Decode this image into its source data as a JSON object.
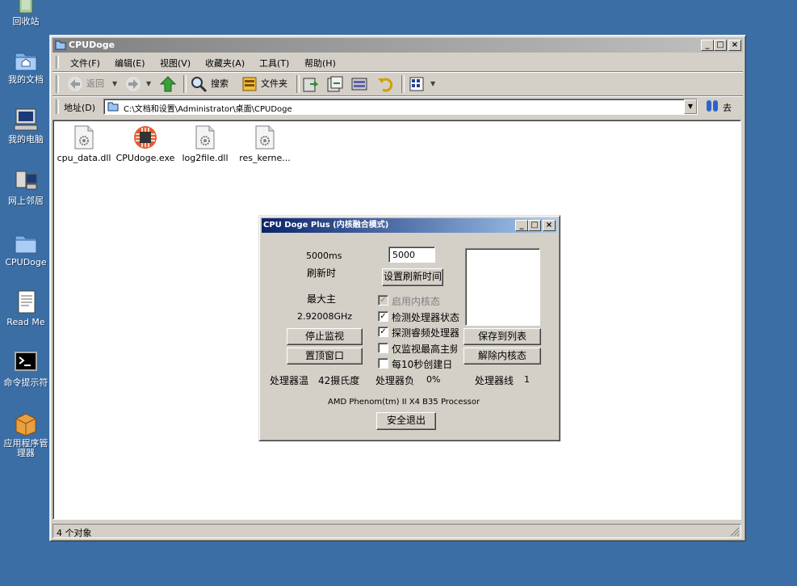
{
  "desktop": {
    "icons": [
      {
        "label": "回收站"
      },
      {
        "label": "我的文档"
      },
      {
        "label": "我的电脑"
      },
      {
        "label": "网上邻居"
      },
      {
        "label": "CPUDoge"
      },
      {
        "label": "Read Me"
      },
      {
        "label": "命令提示符"
      },
      {
        "label": "应用程序管理器"
      }
    ]
  },
  "explorer": {
    "title": "CPUDoge",
    "menu": [
      "文件(F)",
      "编辑(E)",
      "视图(V)",
      "收藏夹(A)",
      "工具(T)",
      "帮助(H)"
    ],
    "toolbar": {
      "back": "返回",
      "search": "搜索",
      "folders": "文件夹"
    },
    "address": {
      "label": "地址(D)",
      "value": "C:\\文档和设置\\Administrator\\桌面\\CPUDoge",
      "go": "去"
    },
    "files": [
      {
        "name": "cpu_data.dll"
      },
      {
        "name": "CPUdoge.exe"
      },
      {
        "name": "log2file.dll"
      },
      {
        "name": "res_kerne..."
      }
    ],
    "status": "4 个对象"
  },
  "dialog": {
    "title": "CPU Doge Plus (内核融合模式)",
    "refresh_ms": "5000ms",
    "refresh_label": "刷新时",
    "interval_input": "5000",
    "set_interval_button": "设置刷新时间",
    "max_label": "最大主",
    "max_freq": "2.92008GHz",
    "stop_button": "停止监视",
    "top_button": "置顶窗口",
    "checks": [
      {
        "label": "启用内核态",
        "checked": true,
        "disabled": true
      },
      {
        "label": "检测处理器状态",
        "checked": true,
        "disabled": false
      },
      {
        "label": "探测睿频处理器",
        "checked": true,
        "disabled": false
      },
      {
        "label": "仅监视最高主频",
        "checked": false,
        "disabled": false
      },
      {
        "label": "每10秒创建日",
        "checked": false,
        "disabled": false
      }
    ],
    "save_button": "保存到列表",
    "remove_button": "解除内核态",
    "temp_label": "处理器温",
    "temp_value": "42摄氏度",
    "load_label": "处理器负",
    "load_value": "0%",
    "threads_label": "处理器线",
    "threads_value": "1",
    "cpu_name": "AMD Phenom(tm) II X4 B35 Processor",
    "exit_button": "安全退出"
  },
  "colors": {
    "desktop": "#3a6ea5",
    "title_active": "#0a246a",
    "title_inactive": "#808080",
    "face": "#d4d0c8"
  }
}
